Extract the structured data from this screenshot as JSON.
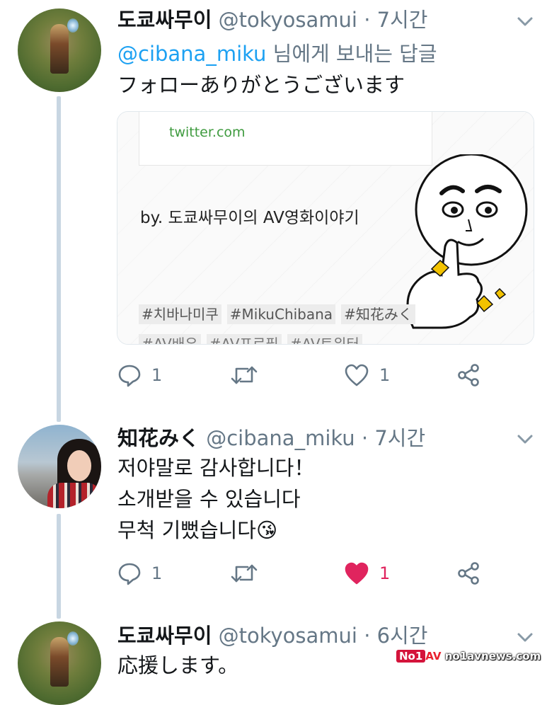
{
  "tweets": [
    {
      "name": "도쿄싸무이",
      "handle": "@tokyosamui",
      "dot": "·",
      "time": "7시간",
      "reply_to_mention": "@cibana_miku",
      "reply_to_suffix": " 님에게 보내는 답글",
      "text": "フォローありがとうございます",
      "card": {
        "url": "twitter.com",
        "title": "by. 도쿄싸무이의 AV영화이야기",
        "tags_row1": [
          "#치바나미쿠",
          "#MikuChibana",
          "#知花みく"
        ],
        "tags_row2": [
          "#AV배우",
          "#AV프로필",
          "#AV트위터"
        ]
      },
      "actions": {
        "replies": "1",
        "retweets": "",
        "likes": "1",
        "liked": false
      }
    },
    {
      "name": "知花みく",
      "handle": "@cibana_miku",
      "dot": "·",
      "time": "7시간",
      "lines": [
        "저야말로 감사합니다！",
        "소개받을 수 있습니다",
        "무척 기뻤습니다"
      ],
      "emoji": "😘",
      "actions": {
        "replies": "1",
        "retweets": "",
        "likes": "1",
        "liked": true
      }
    },
    {
      "name": "도쿄싸무이",
      "handle": "@tokyosamui",
      "dot": "·",
      "time": "6시간",
      "text": "応援します。"
    }
  ],
  "icons": {
    "reply": "reply-icon",
    "retweet": "retweet-icon",
    "like": "heart-icon",
    "share": "share-icon",
    "more": "chevron-down-icon"
  },
  "colors": {
    "accent": "#1da1f2",
    "like": "#e0245e",
    "muted": "#657786",
    "thread_line": "#c8d6e2"
  },
  "watermark": {
    "badge": "No1",
    "av": "AV",
    "site": "no1avnews.com"
  }
}
